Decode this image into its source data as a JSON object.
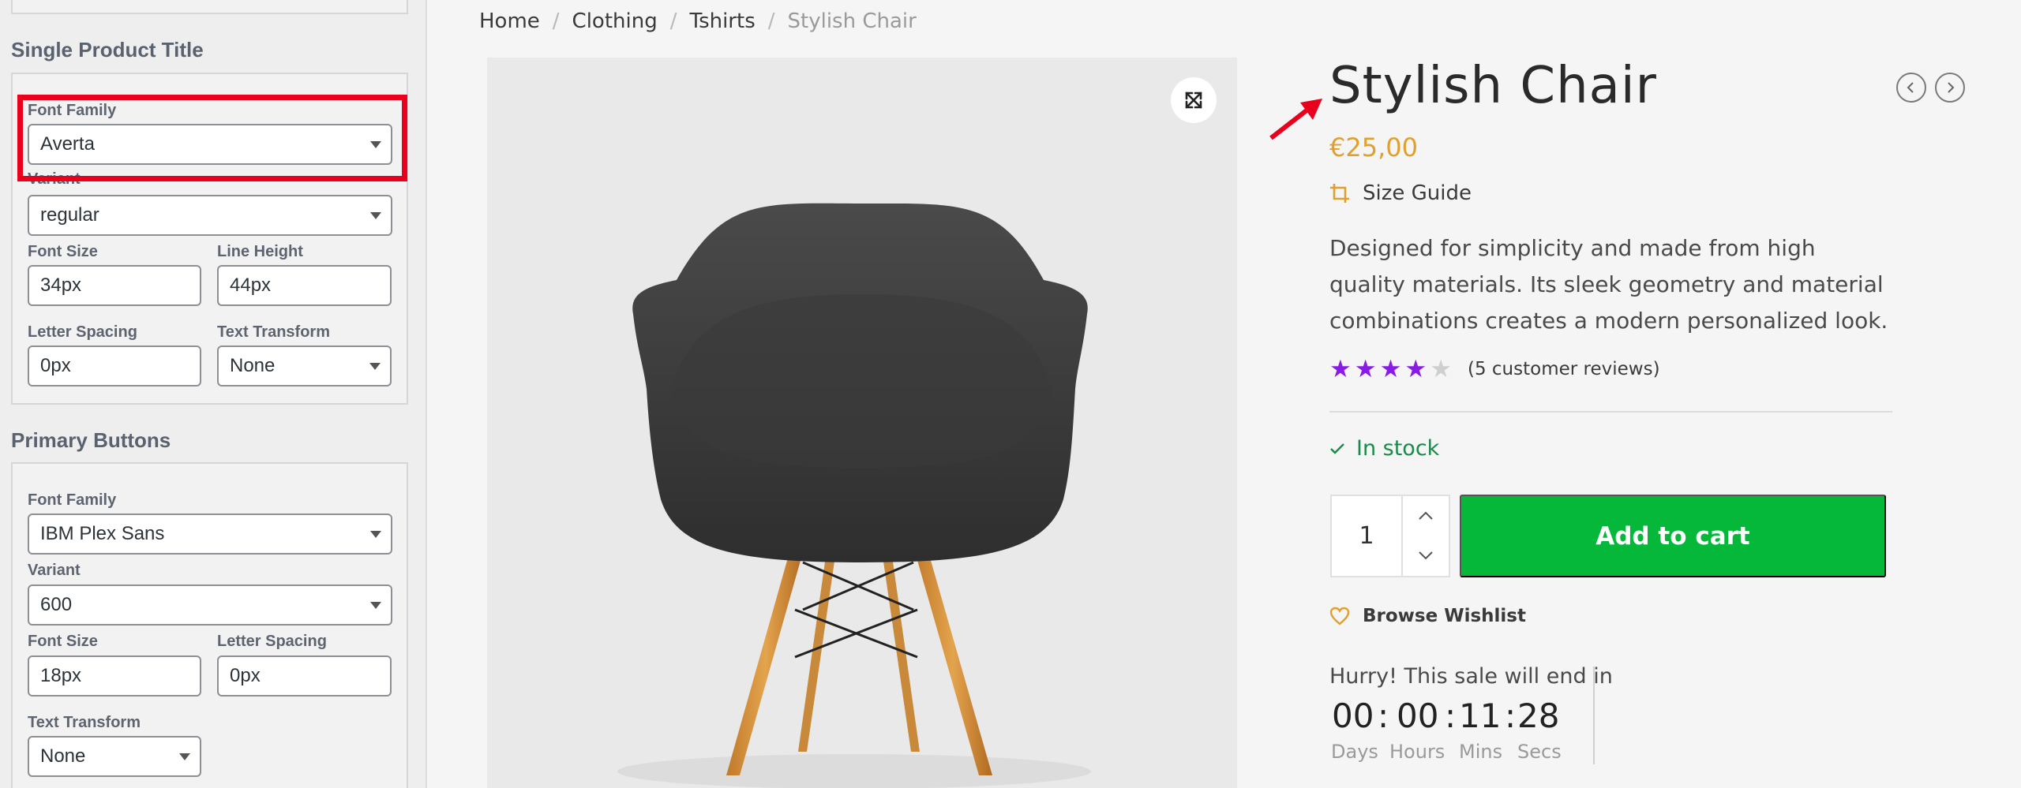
{
  "sidebar": {
    "single_title": {
      "heading": "Single Product Title",
      "font_family_label": "Font Family",
      "font_family_value": "Averta",
      "variant_label": "Variant",
      "variant_value": "regular",
      "font_size_label": "Font Size",
      "font_size_value": "34px",
      "line_height_label": "Line Height",
      "line_height_value": "44px",
      "letter_spacing_label": "Letter Spacing",
      "letter_spacing_value": "0px",
      "text_transform_label": "Text Transform",
      "text_transform_value": "None"
    },
    "primary_buttons": {
      "heading": "Primary Buttons",
      "font_family_label": "Font Family",
      "font_family_value": "IBM Plex Sans",
      "variant_label": "Variant",
      "variant_value": "600",
      "font_size_label": "Font Size",
      "font_size_value": "18px",
      "letter_spacing_label": "Letter Spacing",
      "letter_spacing_value": "0px",
      "text_transform_label": "Text Transform",
      "text_transform_value": "None"
    }
  },
  "breadcrumb": {
    "items": [
      "Home",
      "Clothing",
      "Tshirts"
    ],
    "separator": "/",
    "current": "Stylish Chair"
  },
  "product": {
    "title": "Stylish Chair",
    "price": "€25,00",
    "size_guide": "Size Guide",
    "description": "Designed for simplicity and made from high quality materials. Its sleek geometry and material combinations creates a modern personalized look.",
    "rating": 4,
    "rating_max": 5,
    "reviews": "(5 customer reviews)",
    "stock": "In stock",
    "quantity": "1",
    "add_to_cart": "Add to cart",
    "wishlist": "Browse Wishlist"
  },
  "countdown": {
    "heading": "Hurry! This sale will end in",
    "days": "00",
    "hours": "00",
    "mins": "11",
    "secs": "28",
    "sep": ":",
    "days_label": "Days",
    "hours_label": "Hours",
    "mins_label": "Mins",
    "secs_label": "Secs"
  },
  "colors": {
    "accent_price": "#e0a030",
    "cart_button": "#05b83a",
    "star_filled": "#8a1be6",
    "star_empty": "#cfcfcf",
    "stock": "#1a8a4a",
    "highlight": "#e8001d"
  },
  "icons": {
    "zoom": "expand-icon",
    "size_guide": "crop-icon",
    "prev": "chevron-left-icon",
    "next": "chevron-right-icon",
    "stock": "check-icon",
    "wishlist": "heart-icon",
    "qty_up": "chevron-up-icon",
    "qty_down": "chevron-down-icon"
  }
}
